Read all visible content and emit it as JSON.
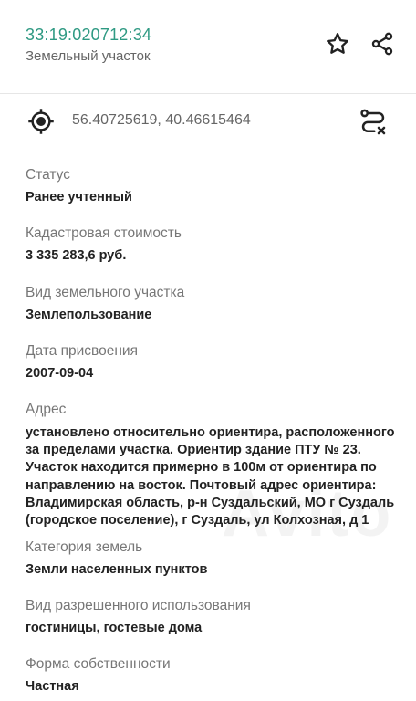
{
  "header": {
    "cadastral_number": "33:19:020712:34",
    "object_type": "Земельный участок"
  },
  "location": {
    "coordinates": "56.40725619, 40.46615464"
  },
  "fields": {
    "status": {
      "label": "Статус",
      "value": "Ранее учтенный"
    },
    "cost": {
      "label": "Кадастровая стоимость",
      "value": "3 335 283,6 руб."
    },
    "kind": {
      "label": "Вид земельного участка",
      "value": "Землепользование"
    },
    "date": {
      "label": "Дата присвоения",
      "value": "2007-09-04"
    },
    "address": {
      "label": "Адрес",
      "value": "установлено относительно ориентира, расположенного за пределами участка. Ориентир здание ПТУ № 23. Участок находится примерно в 100м от ориентира по направлению на восток. Почтовый адрес ориентира: Владимирская область, р-н Суздальский, МО г Суздаль (городское поселение), г Суздаль, ул Колхозная, д 1"
    },
    "category": {
      "label": "Категория земель",
      "value": "Земли населенных пунктов"
    },
    "use": {
      "label": "Вид разрешенного использования",
      "value": "гостиницы, гостевые дома"
    },
    "ownership": {
      "label": "Форма собственности",
      "value": "Частная"
    }
  },
  "watermark": "Avito",
  "colors": {
    "accent": "#2f9a83",
    "label": "#777777",
    "text": "#222222"
  },
  "icons": [
    "star-icon",
    "share-icon",
    "target-icon",
    "route-icon"
  ]
}
